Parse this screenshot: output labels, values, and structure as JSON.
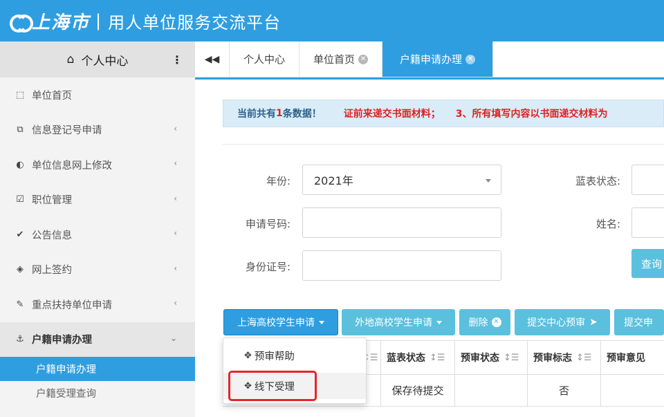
{
  "header": {
    "logo_city": "上海市",
    "separator": "|",
    "title": "用人单位服务交流平台",
    "logo_icon": "shanghai-logo-icon"
  },
  "sidebar": {
    "title": "个人中心",
    "home_icon": "home-icon",
    "menu_icon": "kebab-icon",
    "items": [
      {
        "label": "单位首页",
        "icon": "bookmark-icon",
        "glyph": "⬚",
        "has_chevron": false
      },
      {
        "label": "信息登记号申请",
        "icon": "copy-icon",
        "glyph": "⧉",
        "has_chevron": true
      },
      {
        "label": "单位信息网上修改",
        "icon": "adjust-icon",
        "glyph": "◐",
        "has_chevron": true
      },
      {
        "label": "职位管理",
        "icon": "checkbox-icon",
        "glyph": "☑",
        "has_chevron": true
      },
      {
        "label": "公告信息",
        "icon": "check-icon",
        "glyph": "✔",
        "has_chevron": true
      },
      {
        "label": "网上签约",
        "icon": "eye-slash-icon",
        "glyph": "◈",
        "has_chevron": true
      },
      {
        "label": "重点扶持单位申请",
        "icon": "pencil-icon",
        "glyph": "✎",
        "has_chevron": true
      },
      {
        "label": "户籍申请办理",
        "icon": "anchor-icon",
        "glyph": "⚓",
        "has_chevron": true,
        "open": true
      }
    ],
    "sub_items": [
      {
        "label": "户籍申请办理",
        "active": true
      },
      {
        "label": "户籍受理查询",
        "active": false
      }
    ]
  },
  "tabs": {
    "nav_glyph": "◀◀",
    "items": [
      {
        "label": "个人中心",
        "closable": false
      },
      {
        "label": "单位首页",
        "closable": true
      },
      {
        "label": "户籍申请办理",
        "closable": true,
        "active": true
      }
    ]
  },
  "notice": {
    "prefix": "当前共有",
    "count": "1",
    "suffix": "条数据！",
    "scroll_text_1": "证前来递交书面材料；",
    "scroll_text_2": "3、所有填写内容以书面递交材料为"
  },
  "filters": {
    "year_label": "年份:",
    "year_value": "2021年",
    "blue_status_label": "蓝表状态:",
    "app_no_label": "申请号码:",
    "name_label": "姓名:",
    "id_label": "身份证号:",
    "query_button": "查询"
  },
  "toolbar": {
    "btn_shanghai": "上海高校学生申请",
    "btn_other": "外地高校学生申请",
    "btn_delete": "删除",
    "btn_submit_center": "提交中心预审",
    "btn_submit_more": "提交申"
  },
  "dropdown": {
    "items": [
      {
        "label": "预审帮助"
      },
      {
        "label": "线下受理"
      }
    ]
  },
  "table": {
    "headers": [
      "蓝表状态",
      "预审状态",
      "预审标志",
      "预审意见"
    ],
    "row": [
      "保存待提交",
      "",
      "否",
      ""
    ]
  },
  "colors": {
    "primary": "#2f9ee0",
    "info": "#5bc0de",
    "alert": "#e02020",
    "highlight": "#e8232a"
  }
}
